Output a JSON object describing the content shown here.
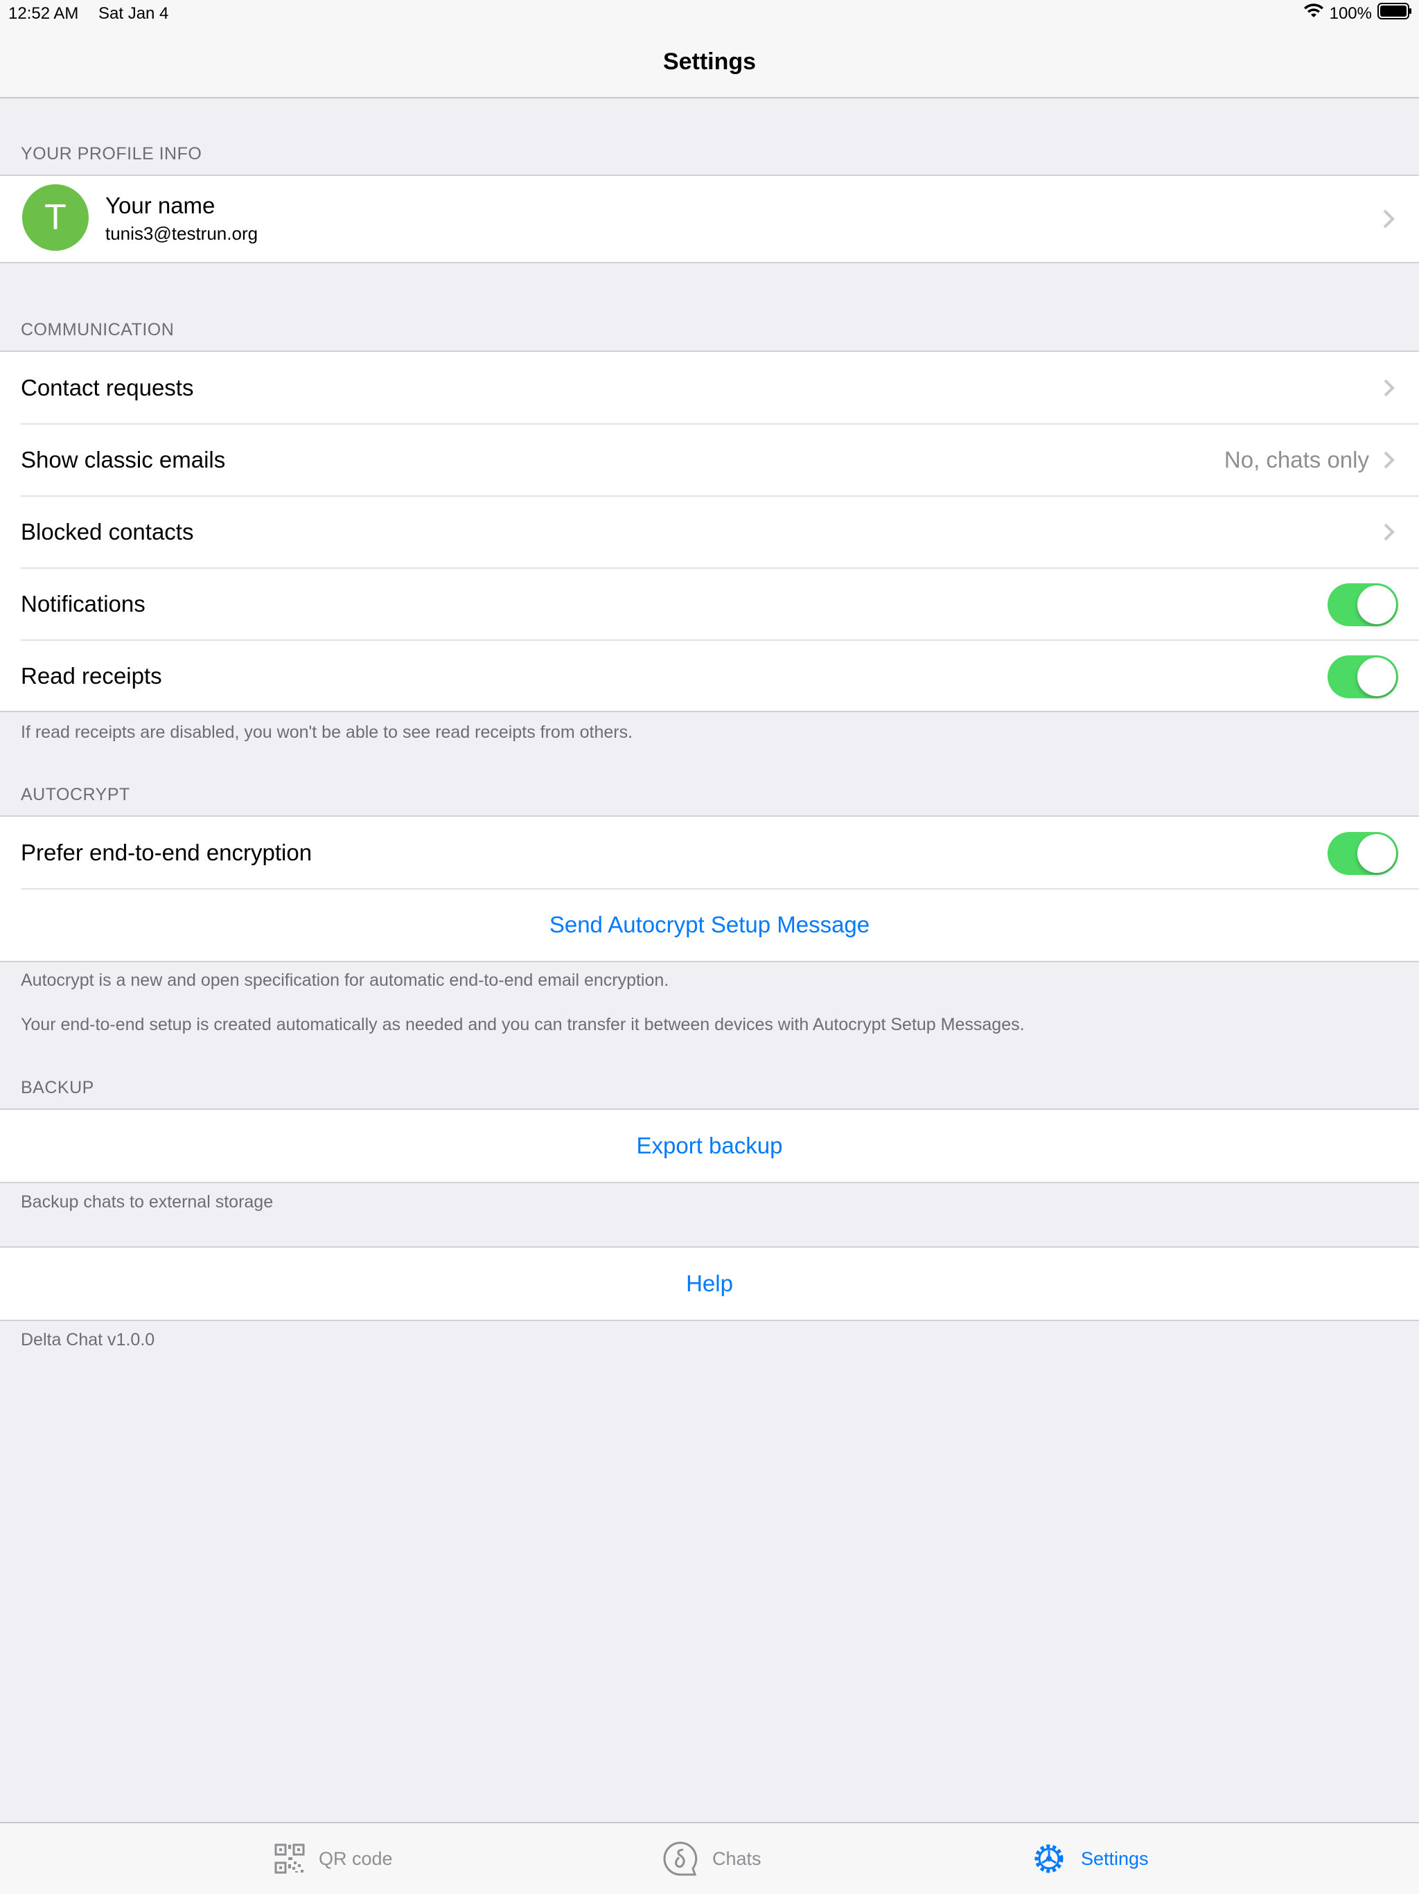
{
  "status_bar": {
    "time": "12:52 AM",
    "date": "Sat Jan 4",
    "battery": "100%"
  },
  "nav": {
    "title": "Settings"
  },
  "profile_section": {
    "header": "YOUR PROFILE INFO",
    "avatar_initial": "T",
    "name": "Your name",
    "email": "tunis3@testrun.org"
  },
  "communication": {
    "header": "COMMUNICATION",
    "contact_requests": "Contact requests",
    "show_classic_emails": "Show classic emails",
    "show_classic_emails_value": "No, chats only",
    "blocked_contacts": "Blocked contacts",
    "notifications": "Notifications",
    "notifications_on": true,
    "read_receipts": "Read receipts",
    "read_receipts_on": true,
    "footer": "If read receipts are disabled, you won't be able to see read receipts from others."
  },
  "autocrypt": {
    "header": "AUTOCRYPT",
    "prefer_e2e": "Prefer end-to-end encryption",
    "prefer_e2e_on": true,
    "send_setup": "Send Autocrypt Setup Message",
    "footer_1": "Autocrypt is a new and open specification for automatic end-to-end email encryption.",
    "footer_2": "Your end-to-end setup is created automatically as needed and you can transfer it between devices with Autocrypt Setup Messages."
  },
  "backup": {
    "header": "BACKUP",
    "export": "Export backup",
    "footer": "Backup chats to external storage"
  },
  "help": {
    "label": "Help",
    "version": "Delta Chat v1.0.0"
  },
  "tabs": [
    {
      "label": "QR code",
      "icon": "qr-code-icon",
      "active": false
    },
    {
      "label": "Chats",
      "icon": "chats-icon",
      "active": false
    },
    {
      "label": "Settings",
      "icon": "gear-icon",
      "active": true
    }
  ],
  "colors": {
    "accent": "#007aff",
    "toggle_on": "#4cd964",
    "avatar": "#6cc04a",
    "background": "#efeff4"
  }
}
